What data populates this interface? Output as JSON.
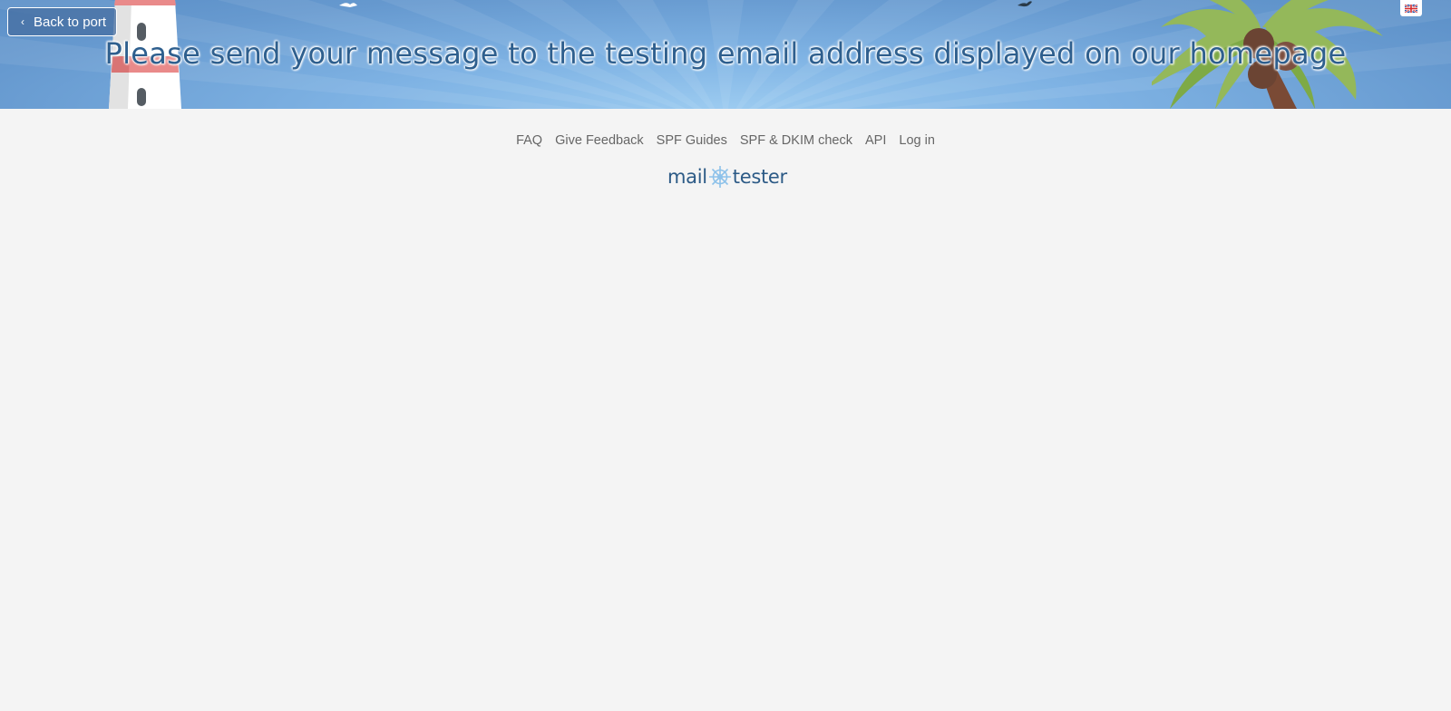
{
  "header": {
    "back_label": "Back to port",
    "title": "Please send your message to the testing email address displayed on our homepage"
  },
  "footer": {
    "links": [
      {
        "label": "FAQ"
      },
      {
        "label": "Give Feedback"
      },
      {
        "label": "SPF Guides"
      },
      {
        "label": "SPF & DKIM check"
      },
      {
        "label": "API"
      },
      {
        "label": "Log in"
      }
    ]
  },
  "logo": {
    "left_text": "mail",
    "right_text": "tester"
  },
  "icons": {
    "back": "chevron-left-icon",
    "language": "uk-flag-icon",
    "logo_wheel": "ship-wheel-icon"
  },
  "colors": {
    "header_blue": "#6699cf",
    "title_text": "#2e5f8e",
    "background": "#f4f4f4",
    "link_text": "#666666",
    "logo_text": "#2c5a86",
    "logo_wheel": "#8ec2ea"
  }
}
